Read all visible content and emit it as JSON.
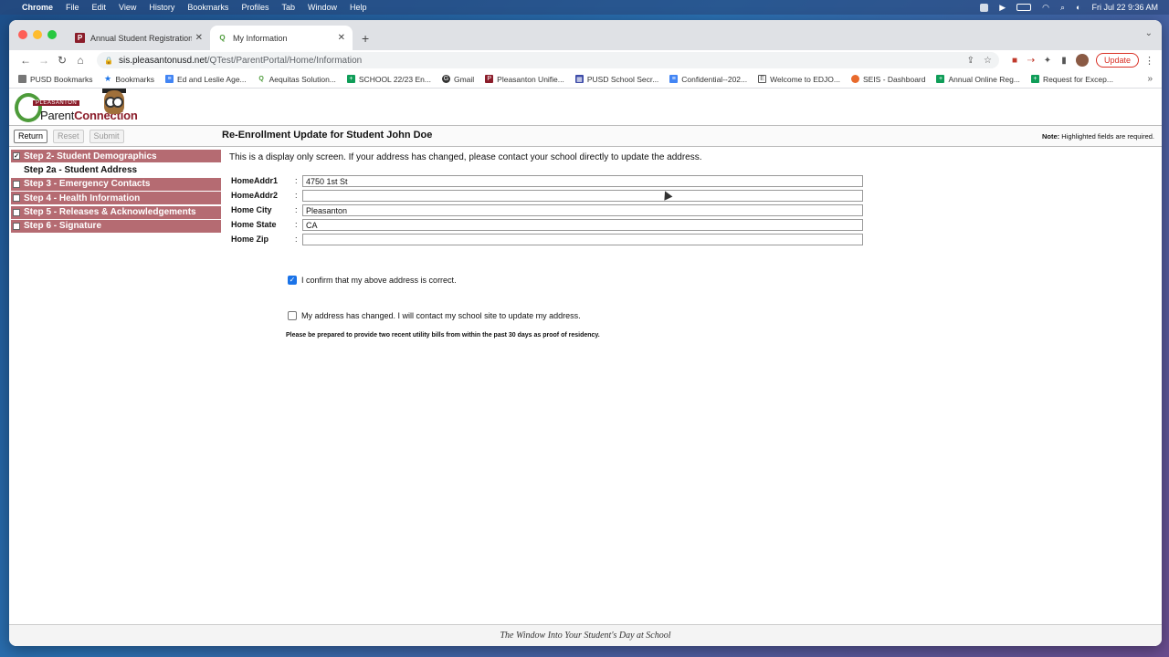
{
  "os_menubar": {
    "app": "Chrome",
    "items": [
      "File",
      "Edit",
      "View",
      "History",
      "Bookmarks",
      "Profiles",
      "Tab",
      "Window",
      "Help"
    ],
    "clock": "Fri Jul 22  9:36 AM"
  },
  "browser": {
    "tabs": [
      {
        "title": "Annual Student Registration -",
        "icon": "pleasanton-p-icon",
        "active": false
      },
      {
        "title": "My Information",
        "icon": "q-logo-icon",
        "active": true
      }
    ],
    "url_host": "sis.pleasantonusd.net",
    "url_path": "/QTest/ParentPortal/Home/Information",
    "update_label": "Update",
    "bookmarks": [
      {
        "label": "PUSD Bookmarks",
        "icon": "folder-icon"
      },
      {
        "label": "Bookmarks",
        "icon": "star-icon"
      },
      {
        "label": "Ed and Leslie Age...",
        "icon": "doc-icon"
      },
      {
        "label": "Aequitas Solution...",
        "icon": "q-icon"
      },
      {
        "label": "SCHOOL 22/23 En...",
        "icon": "sheet-icon"
      },
      {
        "label": "Gmail",
        "icon": "gmail-icon"
      },
      {
        "label": "Pleasanton Unifie...",
        "icon": "pleasanton-icon"
      },
      {
        "label": "PUSD School Secr...",
        "icon": "calendar-icon"
      },
      {
        "label": "Confidential--202...",
        "icon": "doc-icon"
      },
      {
        "label": "Welcome to EDJO...",
        "icon": "edjoin-icon"
      },
      {
        "label": "SEIS - Dashboard",
        "icon": "seis-icon"
      },
      {
        "label": "Annual Online Reg...",
        "icon": "sheet-icon"
      },
      {
        "label": "Request for Excep...",
        "icon": "sheet-icon"
      }
    ]
  },
  "portal": {
    "logo_top": "PLEASANTON",
    "logo_parent": "Parent",
    "logo_connection": "Connection",
    "buttons": {
      "return": "Return",
      "reset": "Reset",
      "submit": "Submit"
    },
    "title": "Re-Enrollment Update for Student John Doe",
    "note_label": "Note:",
    "note_text": " Highlighted fields are required.",
    "steps": [
      {
        "label": "Step 2- Student Demographics",
        "checked": true,
        "sub": false
      },
      {
        "label": "Step 2a - Student Address",
        "checked": false,
        "sub": true
      },
      {
        "label": "Step 3 - Emergency Contacts",
        "checked": false,
        "sub": false
      },
      {
        "label": "Step 4 - Health Information",
        "checked": false,
        "sub": false
      },
      {
        "label": "Step 5 - Releases & Acknowledgements",
        "checked": false,
        "sub": false
      },
      {
        "label": "Step 6 - Signature",
        "checked": false,
        "sub": false
      }
    ],
    "intro": "This is a display only screen. If your address has changed, please contact your school directly to update the address.",
    "fields": [
      {
        "label": "HomeAddr1",
        "value": "4750 1st St"
      },
      {
        "label": "HomeAddr2",
        "value": ""
      },
      {
        "label": "Home City",
        "value": "Pleasanton"
      },
      {
        "label": "Home State",
        "value": "CA"
      },
      {
        "label": "Home Zip",
        "value": ""
      }
    ],
    "confirm_label": "I confirm that my above address is correct.",
    "confirm_checked": true,
    "changed_label": "My address has changed. I will contact my school site to update my address.",
    "changed_checked": false,
    "proof_text": "Please be prepared to provide two recent utility bills from within the past 30 days as proof of residency.",
    "footer": "The Window Into Your Student's Day at School"
  }
}
